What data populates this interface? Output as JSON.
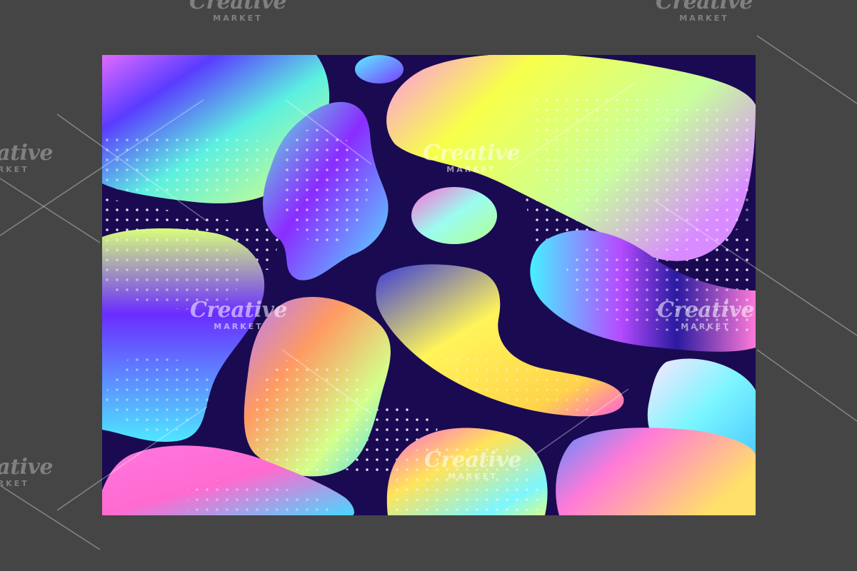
{
  "watermark": {
    "brand": "Creative",
    "sub": "MARKET"
  },
  "colors": {
    "frame_background": "#454545",
    "artwork_background": "#1a0a52",
    "dots": "#ffffff"
  },
  "artwork": {
    "style": "holographic fluid gradient blobs with halftone dot texture"
  }
}
